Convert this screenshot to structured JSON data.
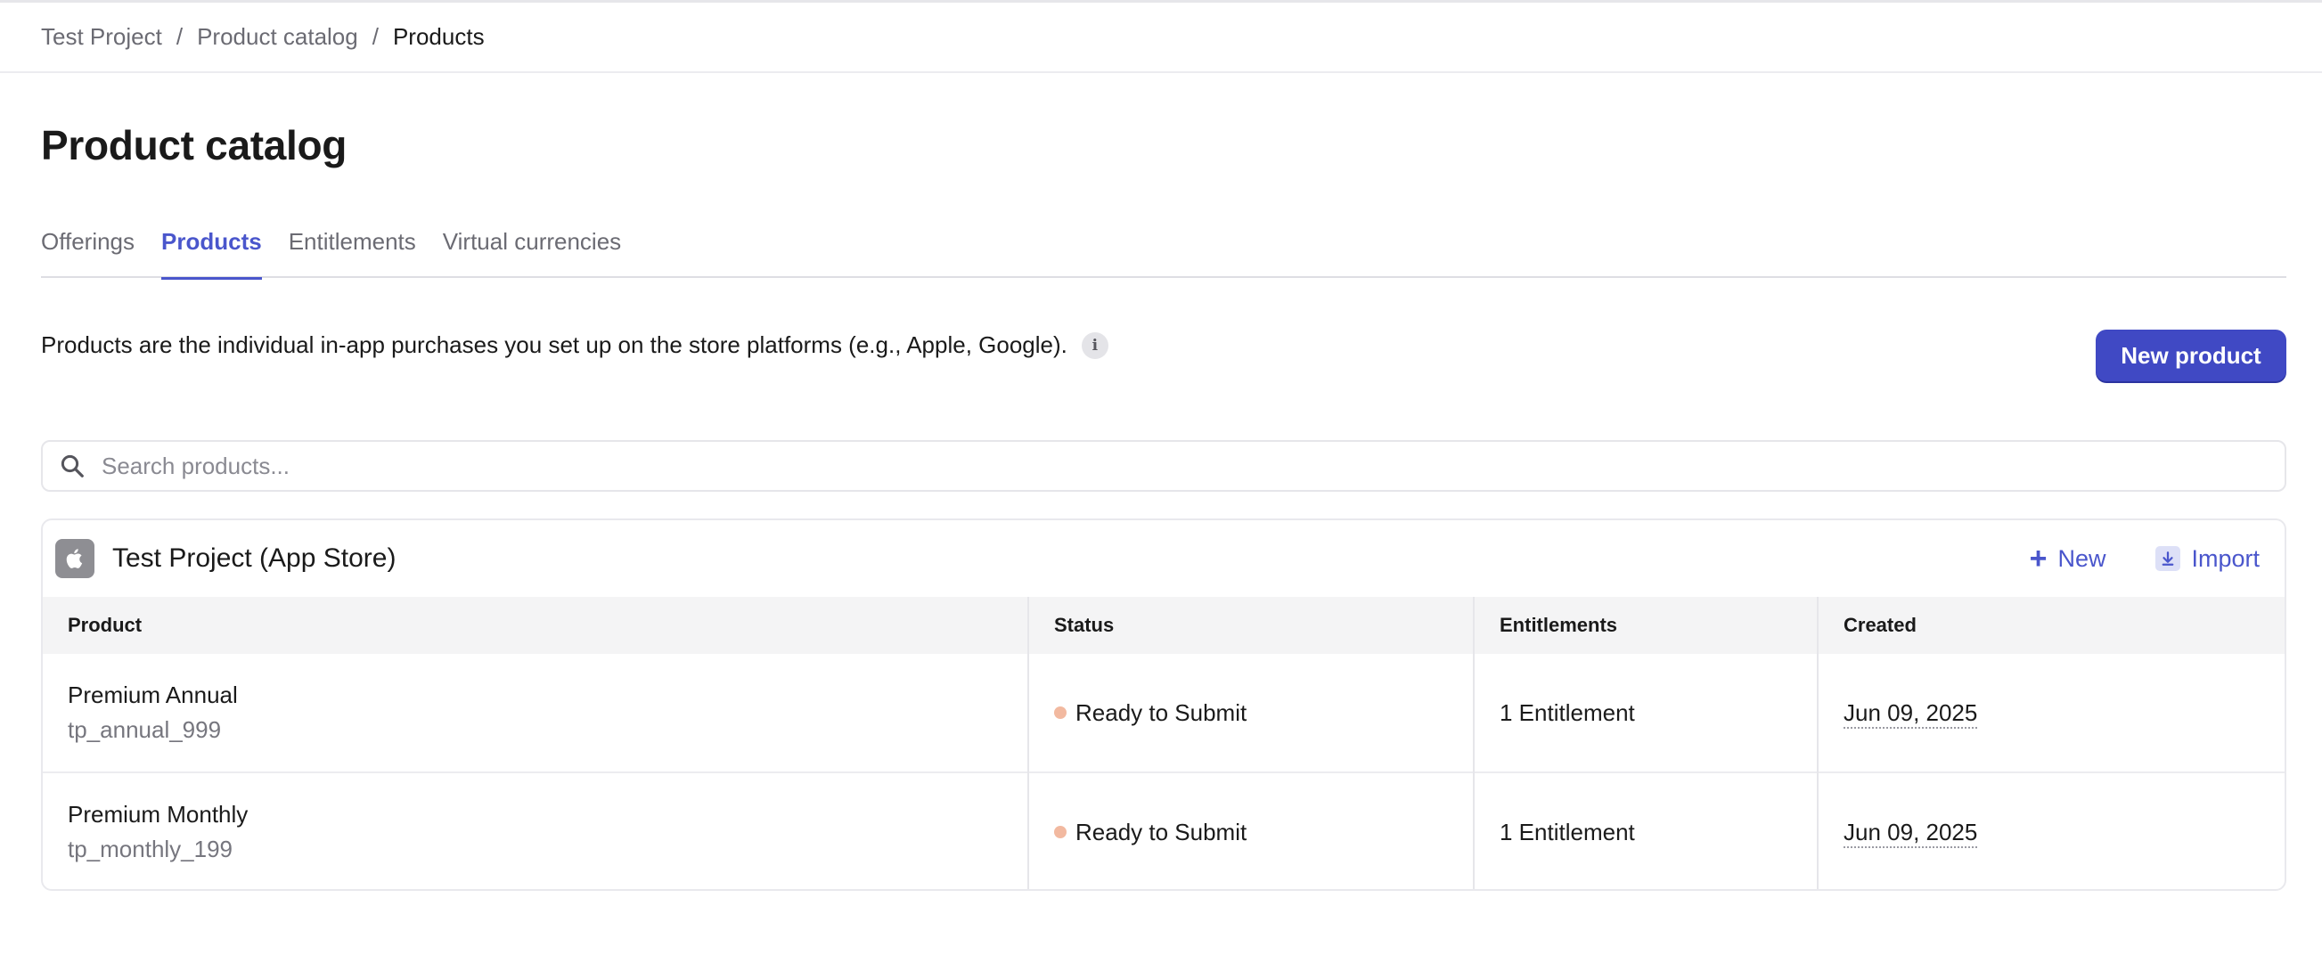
{
  "breadcrumb": {
    "items": [
      "Test Project",
      "Product catalog"
    ],
    "separator": "/",
    "current": "Products"
  },
  "page": {
    "title": "Product catalog"
  },
  "tabs": [
    {
      "label": "Offerings",
      "active": false
    },
    {
      "label": "Products",
      "active": true
    },
    {
      "label": "Entitlements",
      "active": false
    },
    {
      "label": "Virtual currencies",
      "active": false
    }
  ],
  "description": {
    "text": "Products are the individual in-app purchases you set up on the store platforms (e.g., Apple, Google).",
    "info_icon": "info-icon"
  },
  "new_product_button": {
    "label": "New product"
  },
  "search": {
    "placeholder": "Search products...",
    "value": ""
  },
  "store": {
    "name": "Test Project (App Store)",
    "icon": "apple-icon",
    "new_label": "New",
    "import_label": "Import",
    "columns": [
      "Product",
      "Status",
      "Entitlements",
      "Created"
    ],
    "rows": [
      {
        "name": "Premium Annual",
        "identifier": "tp_annual_999",
        "status": "Ready to Submit",
        "entitlements": "1 Entitlement",
        "created": "Jun 09, 2025"
      },
      {
        "name": "Premium Monthly",
        "identifier": "tp_monthly_199",
        "status": "Ready to Submit",
        "entitlements": "1 Entitlement",
        "created": "Jun 09, 2025"
      }
    ]
  },
  "colors": {
    "accent": "#4a56cc",
    "button": "#4049c4",
    "status_dot": "#f2b9a0"
  }
}
